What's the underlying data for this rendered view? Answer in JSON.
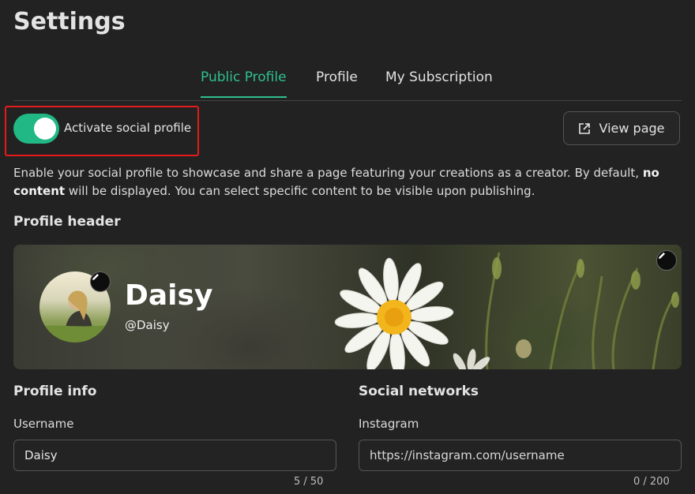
{
  "page": {
    "title": "Settings"
  },
  "tabs": [
    {
      "label": "Public Profile",
      "active": true
    },
    {
      "label": "Profile",
      "active": false
    },
    {
      "label": "My Subscription",
      "active": false
    }
  ],
  "social_toggle": {
    "label": "Activate social profile",
    "checked": true
  },
  "view_page": {
    "label": "View page",
    "icon": "external-link-icon"
  },
  "description": {
    "part1": "Enable your social profile to showcase and share a page featuring your creations as a creator. By default, ",
    "bold1": "no",
    "bold2": "content",
    "part2": " will be displayed. You can select specific content to be visible upon publishing."
  },
  "profile_header": {
    "title": "Profile header",
    "display_name": "Daisy",
    "handle": "@Daisy"
  },
  "profile_info": {
    "title": "Profile info",
    "username_label": "Username",
    "username_value": "Daisy",
    "username_counter": "5 / 50"
  },
  "social_networks": {
    "title": "Social networks",
    "instagram_label": "Instagram",
    "instagram_placeholder": "https://instagram.com/username",
    "instagram_value": "",
    "instagram_counter": "0 / 200"
  },
  "colors": {
    "accent": "#2fc08f",
    "highlight_border": "#e51b1b",
    "background": "#222222"
  }
}
